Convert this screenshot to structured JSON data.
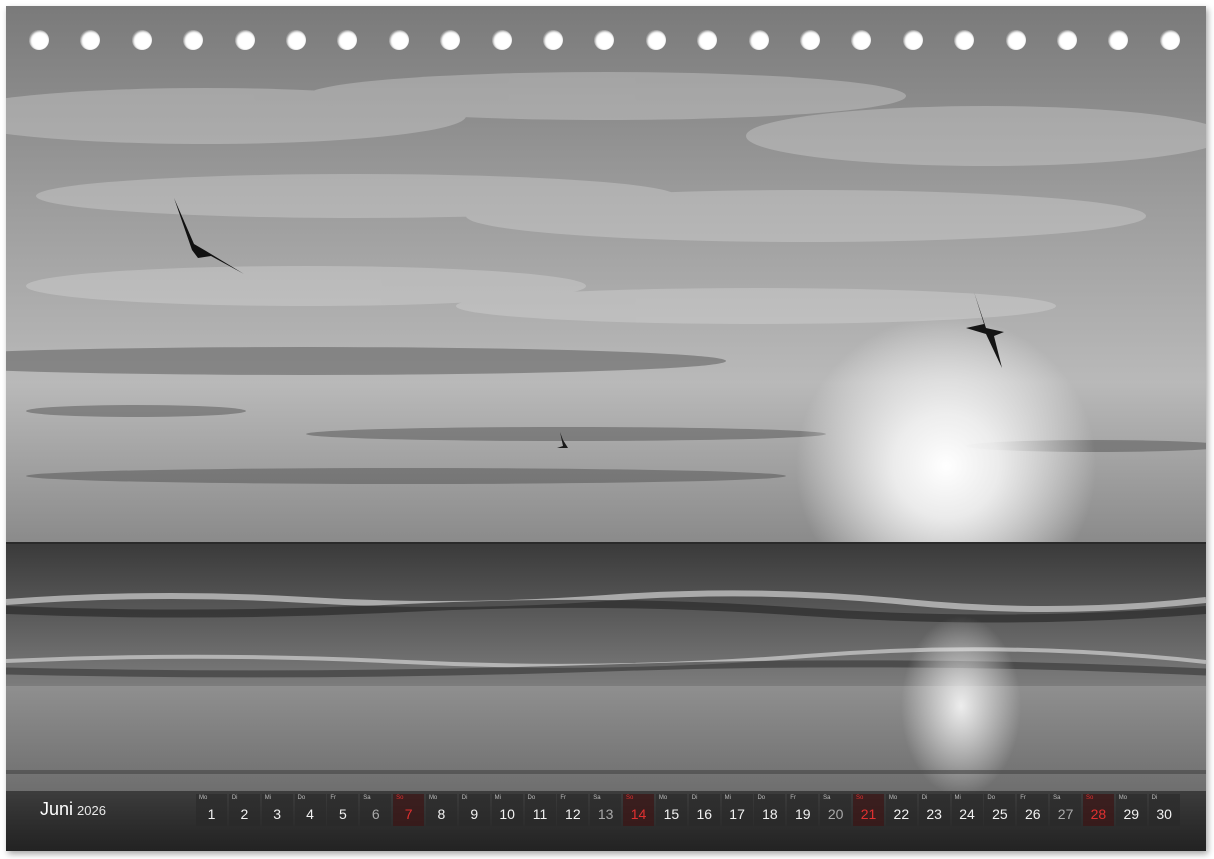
{
  "calendar": {
    "month": "Juni",
    "year": "2026",
    "days": [
      {
        "wd": "Mo",
        "num": "1",
        "type": "weekday"
      },
      {
        "wd": "Di",
        "num": "2",
        "type": "weekday"
      },
      {
        "wd": "Mi",
        "num": "3",
        "type": "weekday"
      },
      {
        "wd": "Do",
        "num": "4",
        "type": "weekday"
      },
      {
        "wd": "Fr",
        "num": "5",
        "type": "weekday"
      },
      {
        "wd": "Sa",
        "num": "6",
        "type": "sat"
      },
      {
        "wd": "So",
        "num": "7",
        "type": "sun"
      },
      {
        "wd": "Mo",
        "num": "8",
        "type": "weekday"
      },
      {
        "wd": "Di",
        "num": "9",
        "type": "weekday"
      },
      {
        "wd": "Mi",
        "num": "10",
        "type": "weekday"
      },
      {
        "wd": "Do",
        "num": "11",
        "type": "weekday"
      },
      {
        "wd": "Fr",
        "num": "12",
        "type": "weekday"
      },
      {
        "wd": "Sa",
        "num": "13",
        "type": "sat"
      },
      {
        "wd": "So",
        "num": "14",
        "type": "sun"
      },
      {
        "wd": "Mo",
        "num": "15",
        "type": "weekday"
      },
      {
        "wd": "Di",
        "num": "16",
        "type": "weekday"
      },
      {
        "wd": "Mi",
        "num": "17",
        "type": "weekday"
      },
      {
        "wd": "Do",
        "num": "18",
        "type": "weekday"
      },
      {
        "wd": "Fr",
        "num": "19",
        "type": "weekday"
      },
      {
        "wd": "Sa",
        "num": "20",
        "type": "sat"
      },
      {
        "wd": "So",
        "num": "21",
        "type": "sun"
      },
      {
        "wd": "Mo",
        "num": "22",
        "type": "weekday"
      },
      {
        "wd": "Di",
        "num": "23",
        "type": "weekday"
      },
      {
        "wd": "Mi",
        "num": "24",
        "type": "weekday"
      },
      {
        "wd": "Do",
        "num": "25",
        "type": "weekday"
      },
      {
        "wd": "Fr",
        "num": "26",
        "type": "weekday"
      },
      {
        "wd": "Sa",
        "num": "27",
        "type": "sat"
      },
      {
        "wd": "So",
        "num": "28",
        "type": "sun"
      },
      {
        "wd": "Mo",
        "num": "29",
        "type": "weekday"
      },
      {
        "wd": "Di",
        "num": "30",
        "type": "weekday"
      }
    ]
  },
  "colors": {
    "sunday": "#e03030",
    "saturday": "#a9a9a9",
    "text": "#f2f2f2"
  },
  "photo_subject": [
    "sky",
    "clouds",
    "sun",
    "sea",
    "waves",
    "beach",
    "seagull",
    "seagull",
    "seagull"
  ]
}
